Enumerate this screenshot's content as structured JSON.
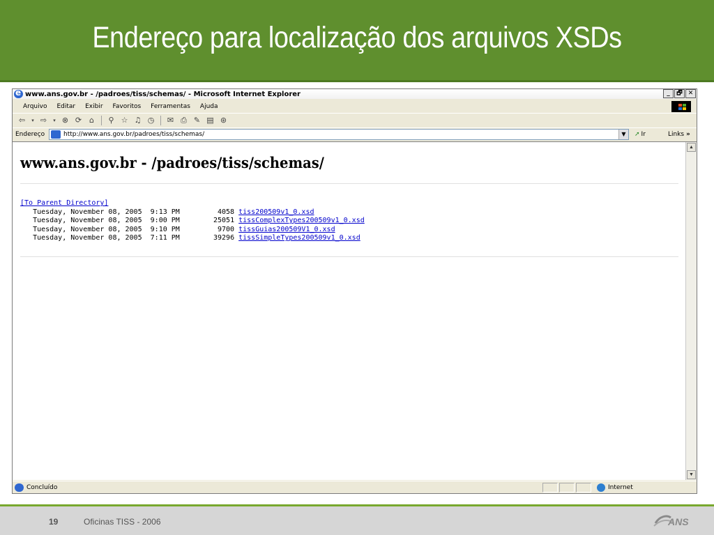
{
  "slide": {
    "title": "Endereço para localização dos arquivos XSDs",
    "number": "19",
    "footer": "Oficinas TISS - 2006",
    "brand_color": "#5f8f2e",
    "logo_text": "ANS"
  },
  "window": {
    "title": "www.ans.gov.br - /padroes/tiss/schemas/ - Microsoft Internet Explorer",
    "controls": {
      "minimize": "_",
      "restore": "🗗",
      "close": "✕"
    }
  },
  "menu": {
    "items": [
      "Arquivo",
      "Editar",
      "Exibir",
      "Favoritos",
      "Ferramentas",
      "Ajuda"
    ]
  },
  "address": {
    "label": "Endereço",
    "value": "http://www.ans.gov.br/padroes/tiss/schemas/",
    "go_label": "Ir",
    "links_label": "Links",
    "links_chevron": "»"
  },
  "page": {
    "heading": "www.ans.gov.br - /padroes/tiss/schemas/",
    "parent_link": "[To Parent Directory]",
    "files": [
      {
        "date": "Tuesday, November 08, 2005",
        "time": "9:13 PM",
        "size": "4058",
        "name": "tiss200509v1_0.xsd"
      },
      {
        "date": "Tuesday, November 08, 2005",
        "time": "9:00 PM",
        "size": "25051",
        "name": "tissComplexTypes200509v1_0.xsd"
      },
      {
        "date": "Tuesday, November 08, 2005",
        "time": "9:10 PM",
        "size": "9700",
        "name": "tissGuias200509V1_0.xsd"
      },
      {
        "date": "Tuesday, November 08, 2005",
        "time": "7:11 PM",
        "size": "39296",
        "name": "tissSimpleTypes200509v1_0.xsd"
      }
    ]
  },
  "status": {
    "text": "Concluído",
    "zone": "Internet"
  }
}
